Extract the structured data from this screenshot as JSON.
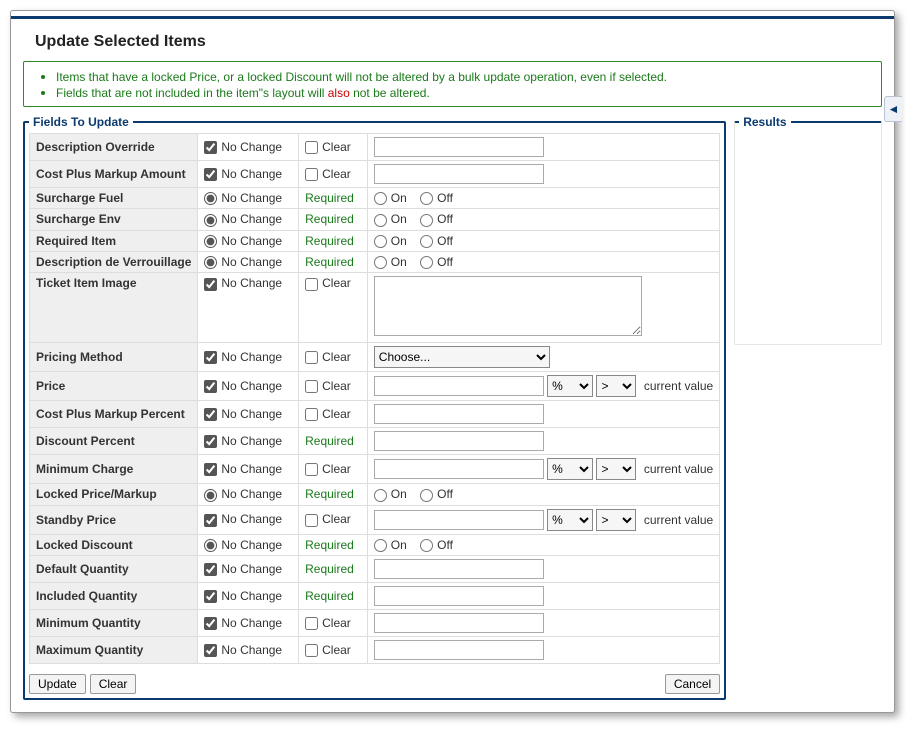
{
  "title": "Update Selected Items",
  "info": {
    "line1": "Items that have a locked Price, or a locked Discount will not be altered by a bulk update operation, even if selected.",
    "line2_a": "Fields that are not included in the item\"s layout will ",
    "line2_also": "also",
    "line2_b": " not be altered."
  },
  "legends": {
    "fields": "Fields To Update",
    "results": "Results"
  },
  "labels": {
    "noChange": "No Change",
    "clear": "Clear",
    "required": "Required",
    "on": "On",
    "off": "Off",
    "currentValue": "current value",
    "choose": "Choose...",
    "pct": "%",
    "gt": ">"
  },
  "rows": {
    "descriptionOverride": "Description Override",
    "costPlusMarkupAmount": "Cost Plus Markup Amount",
    "surchargeFuel": "Surcharge Fuel",
    "surchargeEnv": "Surcharge Env",
    "requiredItem": "Required Item",
    "descriptionDeVerrouillage": "Description de Verrouillage",
    "ticketItemImage": "Ticket Item Image",
    "pricingMethod": "Pricing Method",
    "price": "Price",
    "costPlusMarkupPercent": "Cost Plus Markup Percent",
    "discountPercent": "Discount Percent",
    "minimumCharge": "Minimum Charge",
    "lockedPriceMarkup": "Locked Price/Markup",
    "standbyPrice": "Standby Price",
    "lockedDiscount": "Locked Discount",
    "defaultQuantity": "Default Quantity",
    "includedQuantity": "Included Quantity",
    "minimumQuantity": "Minimum Quantity",
    "maximumQuantity": "Maximum Quantity"
  },
  "buttons": {
    "update": "Update",
    "clear": "Clear",
    "cancel": "Cancel"
  }
}
